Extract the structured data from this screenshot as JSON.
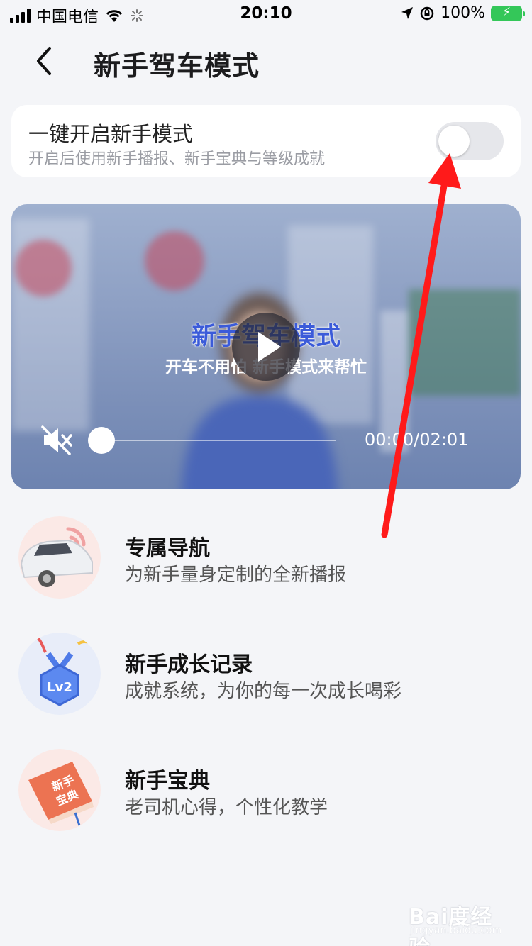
{
  "status_bar": {
    "carrier": "中国电信",
    "time": "20:10",
    "battery_percent": "100%",
    "battery_level": 1.0,
    "icons": [
      "signal-icon",
      "wifi-icon",
      "loading-icon",
      "location-icon",
      "rotation-lock-icon",
      "battery-charging-icon"
    ]
  },
  "header": {
    "title": "新手驾车模式",
    "back_icon": "chevron-left-icon"
  },
  "toggle_card": {
    "title": "一键开启新手模式",
    "subtitle": "开启后使用新手播报、新手宝典与等级成就",
    "enabled": false
  },
  "video": {
    "title": "新手驾车模式",
    "subtitle": "开车不用怕 新手模式来帮忙",
    "time": "00:00/02:01",
    "progress": 0.0,
    "muted": true
  },
  "features": [
    {
      "title": "专属导航",
      "subtitle": "为新手量身定制的全新播报",
      "icon": "car-icon"
    },
    {
      "title": "新手成长记录",
      "subtitle": "成就系统，为你的每一次成长喝彩",
      "icon": "medal-lv2-icon"
    },
    {
      "title": "新手宝典",
      "subtitle": "老司机心得，个性化教学",
      "icon": "guide-book-icon"
    }
  ],
  "watermark": {
    "text": "Bai度经验",
    "url": "jingyan.baidu.com"
  },
  "colors": {
    "background": "#f4f5f8",
    "accent_blue": "#3b5bd9",
    "annotation_red": "#ff1a1a",
    "battery_green": "#34c759"
  }
}
